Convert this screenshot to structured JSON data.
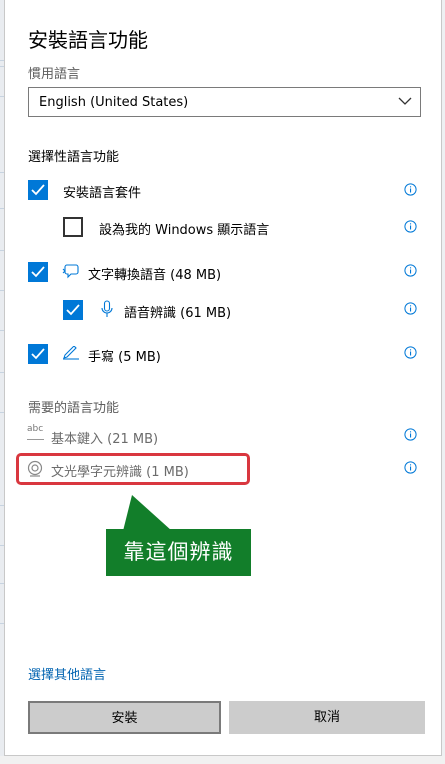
{
  "dialog": {
    "title": "安裝語言功能",
    "preferred_label": "慣用語言",
    "language_value": "English (United States)",
    "optional_heading": "選擇性語言功能",
    "required_heading": "需要的語言功能",
    "link": "選擇其他語言",
    "install_button": "安裝",
    "cancel_button": "取消"
  },
  "optional_features": [
    {
      "label": "安裝語言套件",
      "checked": true
    },
    {
      "label": "設為我的 Windows 顯示語言",
      "checked": false
    },
    {
      "label": "文字轉換語音 (48 MB)",
      "checked": true,
      "icon": "speech-bubble-icon"
    },
    {
      "label": "語音辨識 (61 MB)",
      "checked": true,
      "icon": "microphone-icon"
    },
    {
      "label": "手寫 (5 MB)",
      "checked": true,
      "icon": "pen-icon"
    }
  ],
  "required_features": [
    {
      "label": "基本鍵入 (21 MB)",
      "icon": "abc-icon"
    },
    {
      "label": "文光學字元辨識 (1 MB)",
      "icon": "ocr-icon"
    }
  ],
  "annotation": {
    "text": "靠這個辨識",
    "box_color": "#127e2a",
    "highlight_color": "#d9373f"
  },
  "colors": {
    "accent": "#0078d7",
    "link": "#0063b1",
    "button": "#cccccc"
  }
}
